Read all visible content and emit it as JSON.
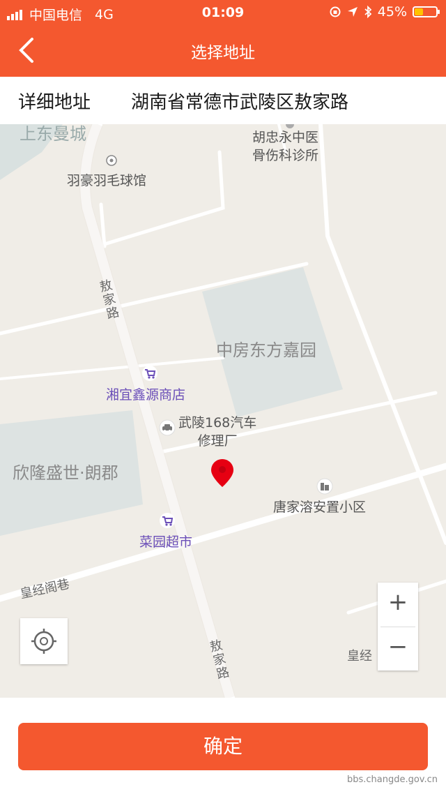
{
  "status_bar": {
    "carrier": "中国电信",
    "network": "4G",
    "time": "01:09",
    "battery": "45%",
    "battery_level": 0.45,
    "battery_color": "#ffc200"
  },
  "header": {
    "title": "选择地址",
    "back_icon": "chevron-left-icon",
    "background": "#f4582f"
  },
  "address": {
    "label": "详细地址",
    "value": "湖南省常德市武陵区敖家路"
  },
  "map": {
    "labels": {
      "top_left": "上东曼城",
      "badminton": "羽豪羽毛球馆",
      "clinic_line1": "胡忠永中医",
      "clinic_line2": "骨伤科诊所",
      "road_aojia_top": "敖家路",
      "garden": "中房东方嘉园",
      "shop": "湘宜鑫源商店",
      "repair_line1": "武陵168汽车",
      "repair_line2": "修理厂",
      "xinlong": "欣隆盛世·朗郡",
      "tangjia": "唐家溶安置小区",
      "supermarket": "菜园超市",
      "huangjing_lane": "皇经阁巷",
      "road_aojia_bottom": "敖家路",
      "huangjing_right": "皇经"
    },
    "controls": {
      "zoom_in": "+",
      "zoom_out": "−",
      "locate_icon": "crosshair-icon"
    }
  },
  "confirm_button": "确定",
  "watermark": "bbs.changde.gov.cn"
}
